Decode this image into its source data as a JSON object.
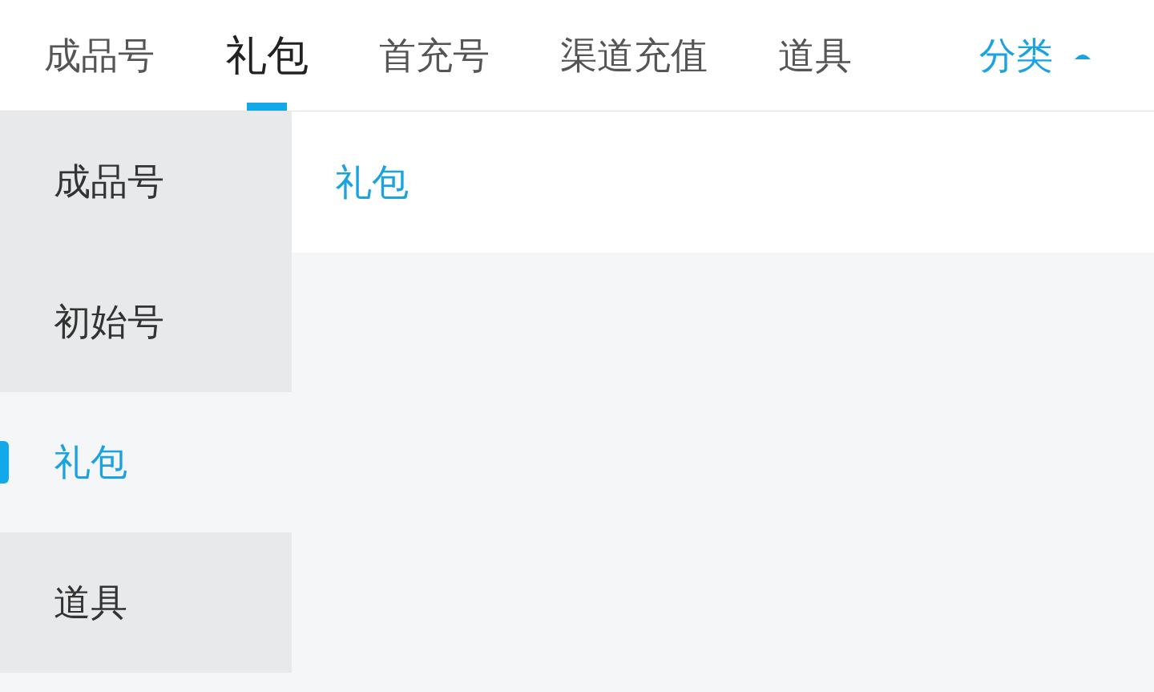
{
  "tabs": [
    {
      "label": "成品号",
      "selected": false
    },
    {
      "label": "礼包",
      "selected": true
    },
    {
      "label": "首充号",
      "selected": false
    },
    {
      "label": "渠道充值",
      "selected": false
    },
    {
      "label": "道具",
      "selected": false
    }
  ],
  "category_button": {
    "label": "分类",
    "expanded": true
  },
  "sidebar": {
    "items": [
      {
        "label": "成品号",
        "selected": false
      },
      {
        "label": "初始号",
        "selected": false
      },
      {
        "label": "礼包",
        "selected": true
      },
      {
        "label": "道具",
        "selected": false
      }
    ]
  },
  "content": {
    "heading": "礼包"
  }
}
